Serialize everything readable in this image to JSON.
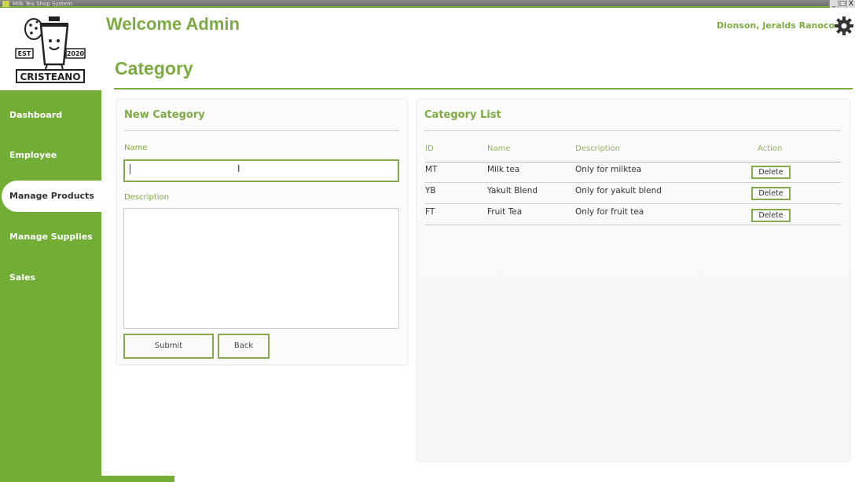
{
  "window": {
    "title": "Milk Tea Shop System",
    "controls": [
      "_",
      "□",
      "X"
    ]
  },
  "header": {
    "welcome": "Welcome Admin",
    "user_name": "Dionson, Jeralds Ranoco",
    "page_title": "Category"
  },
  "logo": {
    "brand": "CRISTEANO",
    "est": "EST",
    "year": "2020"
  },
  "sidebar": {
    "items": [
      {
        "label": "Dashboard",
        "active": false
      },
      {
        "label": "Employee",
        "active": false
      },
      {
        "label": "Manage Products",
        "active": true
      },
      {
        "label": "Manage Supplies",
        "active": false
      },
      {
        "label": "Sales",
        "active": false
      }
    ]
  },
  "new_category": {
    "title": "New Category",
    "name_label": "Name",
    "name_value": "",
    "description_label": "Description",
    "description_value": "",
    "submit_label": "Submit",
    "back_label": "Back"
  },
  "category_list": {
    "title": "Category List",
    "columns": [
      "ID",
      "Name",
      "Description",
      "Action"
    ],
    "rows": [
      {
        "id": "MT",
        "name": "Milk tea",
        "description": "Only for milktea",
        "action": "Delete"
      },
      {
        "id": "YB",
        "name": "Yakult Blend",
        "description": "Only for yakult blend",
        "action": "Delete"
      },
      {
        "id": "FT",
        "name": "Fruit Tea",
        "description": "Only for fruit tea",
        "action": "Delete"
      }
    ]
  },
  "colors": {
    "accent": "#7cab42",
    "sidebar": "#72ad35",
    "border": "#86a84e"
  }
}
